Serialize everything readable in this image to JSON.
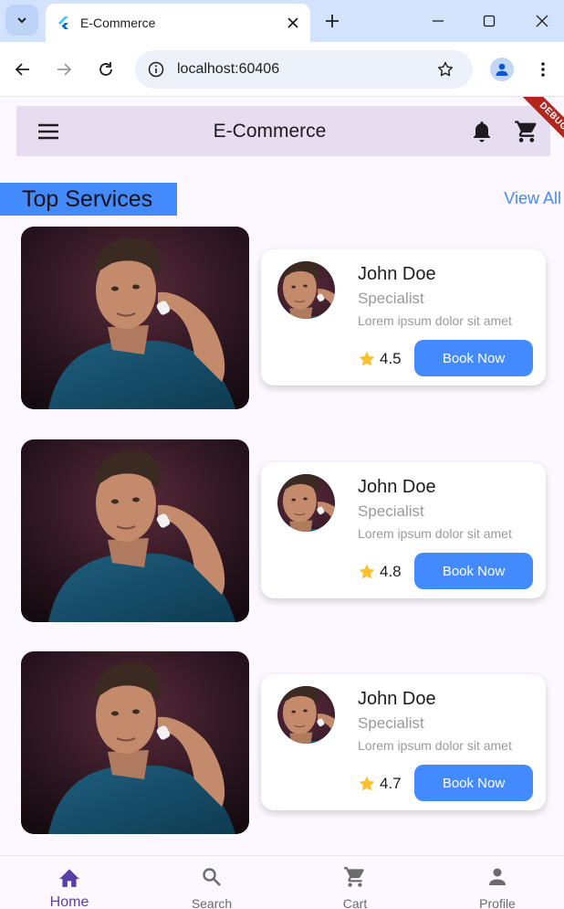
{
  "browser": {
    "tab_title": "E-Commerce",
    "url": "localhost:60406"
  },
  "app": {
    "title": "E-Commerce",
    "debug_label": "DEBUG",
    "section_title": "Top Services",
    "view_all": "View All"
  },
  "services": [
    {
      "name": "John Doe",
      "role": "Specialist",
      "description": "Lorem ipsum dolor sit amet",
      "rating": "4.5",
      "button": "Book Now"
    },
    {
      "name": "John Doe",
      "role": "Specialist",
      "description": "Lorem ipsum dolor sit amet",
      "rating": "4.8",
      "button": "Book Now"
    },
    {
      "name": "John Doe",
      "role": "Specialist",
      "description": "Lorem ipsum dolor sit amet",
      "rating": "4.7",
      "button": "Book Now"
    }
  ],
  "bottom_nav": [
    {
      "label": "Home",
      "icon": "home-icon",
      "active": true
    },
    {
      "label": "Search",
      "icon": "search-icon",
      "active": false
    },
    {
      "label": "Cart",
      "icon": "cart-icon",
      "active": false
    },
    {
      "label": "Profile",
      "icon": "person-icon",
      "active": false
    }
  ],
  "colors": {
    "accent": "#448aff",
    "app_bar": "#e6def0",
    "background": "#fdf7ff",
    "active_nav": "#5b3fa8",
    "star": "#fbc02d"
  }
}
